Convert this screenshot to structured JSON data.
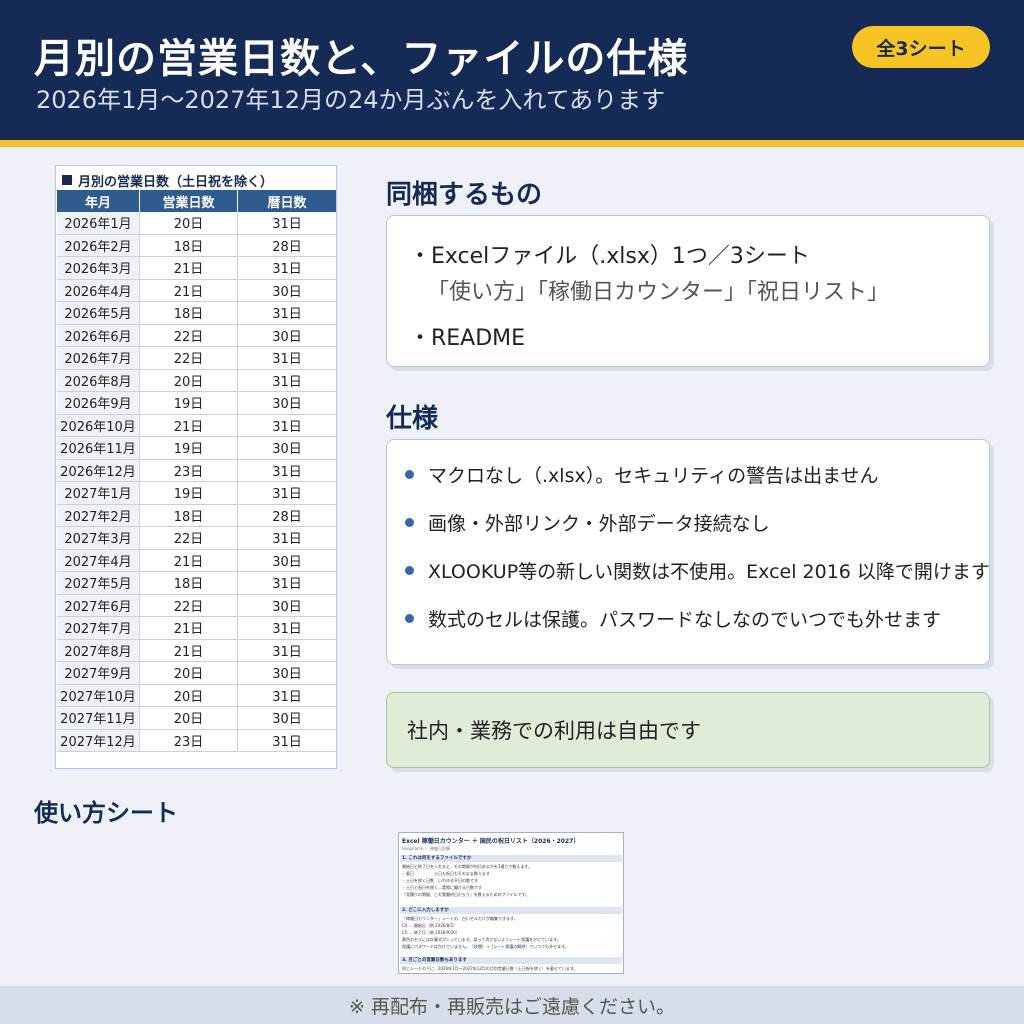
{
  "header": {
    "title": "月別の営業日数と、ファイルの仕様",
    "subtitle": "2026年1月〜2027年12月の24か月ぶんを入れてあります",
    "badge": "全3シート"
  },
  "calendar": {
    "title": "月別の営業日数（土日祝を除く）",
    "columns": [
      "年月",
      "営業日数",
      "暦日数"
    ],
    "rows": [
      [
        "2026年1月",
        "20日",
        "31日"
      ],
      [
        "2026年2月",
        "18日",
        "28日"
      ],
      [
        "2026年3月",
        "21日",
        "31日"
      ],
      [
        "2026年4月",
        "21日",
        "30日"
      ],
      [
        "2026年5月",
        "18日",
        "31日"
      ],
      [
        "2026年6月",
        "22日",
        "30日"
      ],
      [
        "2026年7月",
        "22日",
        "31日"
      ],
      [
        "2026年8月",
        "20日",
        "31日"
      ],
      [
        "2026年9月",
        "19日",
        "30日"
      ],
      [
        "2026年10月",
        "21日",
        "31日"
      ],
      [
        "2026年11月",
        "19日",
        "30日"
      ],
      [
        "2026年12月",
        "23日",
        "31日"
      ],
      [
        "2027年1月",
        "19日",
        "31日"
      ],
      [
        "2027年2月",
        "18日",
        "28日"
      ],
      [
        "2027年3月",
        "22日",
        "31日"
      ],
      [
        "2027年4月",
        "21日",
        "30日"
      ],
      [
        "2027年5月",
        "18日",
        "31日"
      ],
      [
        "2027年6月",
        "22日",
        "30日"
      ],
      [
        "2027年7月",
        "21日",
        "31日"
      ],
      [
        "2027年8月",
        "21日",
        "31日"
      ],
      [
        "2027年9月",
        "20日",
        "30日"
      ],
      [
        "2027年10月",
        "20日",
        "31日"
      ],
      [
        "2027年11月",
        "20日",
        "30日"
      ],
      [
        "2027年12月",
        "23日",
        "31日"
      ]
    ]
  },
  "bundle": {
    "heading": "同梱するもの",
    "line1": "・Excelファイル（.xlsx）1つ／3シート",
    "line2": "「使い方」「稼働日カウンター」「祝日リスト」",
    "line3": "・README"
  },
  "spec": {
    "heading": "仕様",
    "items": [
      "マクロなし（.xlsx）。セキュリティの警告は出ません",
      "画像・外部リンク・外部データ接続なし",
      "XLOOKUP等の新しい関数は不使用。Excel 2016 以降で開けます",
      "数式のセルは保護。パスワードなしなのでいつでも外せます"
    ]
  },
  "note": "社内・業務での利用は自由です",
  "usage": {
    "heading": "使い方シート",
    "thumbnail": {
      "title": "Excel 稼働日カウンター ＋ 国民の祝日リスト（2026・2027）",
      "subtitle": "Shopname ／ 稼働日計算",
      "sections": [
        "1. これは何をするファイルですか",
        "2. どこに入力しますか",
        "3. 月ごとの営業日数もあります"
      ],
      "lines1": [
        "開始日と終了日を入れると、その期間が何日あるかを3通りで数えます。",
        "・暦日　　　　　土日も祝日もそのまま数えます",
        "・土日を除く日数　いわゆる平日の数です",
        "・土日と祝日を除く…実際に働ける日数です",
        "「見積りの期間、これ実働何日だろう」を数えるためのファイルです。"
      ],
      "lines2": [
        "「稼働日カウンター」シートの、白いセルだけが編集できます。",
        "C4 … 開始日（例 2026/8/1）",
        "C5 … 終了日（例 2026/9/30）",
        "黄色のセルには計算式が入っています。誤って消さないようシート保護をかけています。",
        "保護にパスワードはかけていません。［校閲］→［シート保護の解除］でいつでも外せます。"
      ],
      "lines3": [
        "同じシートの下に、2026年1月〜2027年12月の月別営業日数（土日祝を除く）を載せています。"
      ]
    }
  },
  "footer": "※ 再配布・再販売はご遠慮ください。"
}
